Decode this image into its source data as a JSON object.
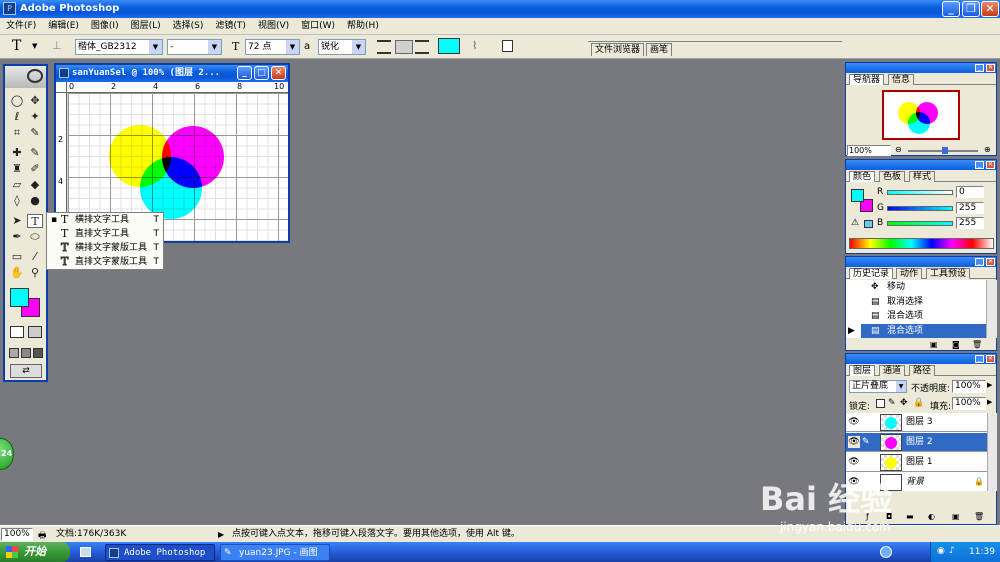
{
  "app": {
    "title": "Adobe Photoshop"
  },
  "menu": [
    "文件(F)",
    "编辑(E)",
    "图像(I)",
    "图层(L)",
    "选择(S)",
    "滤镜(T)",
    "视图(V)",
    "窗口(W)",
    "帮助(H)"
  ],
  "options": {
    "font_family": "楷体_GB2312",
    "font_style": "-",
    "font_size": "72 点",
    "aa_label": "a",
    "aa_value": "锐化",
    "tab_browser": "文件浏览器",
    "tab_brush": "画笔"
  },
  "document": {
    "title": "sanYuanSel @ 100% (图层 2..."
  },
  "ruler": {
    "h": [
      "0",
      "2",
      "4",
      "6",
      "8",
      "10"
    ],
    "v": [
      "2",
      "4"
    ]
  },
  "flyout": [
    {
      "label": "横排文字工具",
      "key": "T",
      "icon": "T"
    },
    {
      "label": "直排文字工具",
      "key": "T",
      "icon": "T"
    },
    {
      "label": "横排文字蒙版工具",
      "key": "T",
      "icon": "T"
    },
    {
      "label": "直排文字蒙版工具",
      "key": "T",
      "icon": "T"
    }
  ],
  "navigator": {
    "tabs": [
      "导航器",
      "信息"
    ],
    "zoom": "100%"
  },
  "color": {
    "tabs": [
      "颜色",
      "色板",
      "样式"
    ],
    "r_label": "R",
    "g_label": "G",
    "b_label": "B",
    "r": "0",
    "g": "255",
    "b": "255"
  },
  "history": {
    "tabs": [
      "历史记录",
      "动作",
      "工具预设"
    ],
    "items": [
      "移动",
      "取消选择",
      "混合选项",
      "混合选项"
    ]
  },
  "layers": {
    "tabs": [
      "图层",
      "通道",
      "路径"
    ],
    "blend": "正片叠底",
    "opacity_label": "不透明度:",
    "opacity": "100%",
    "lock_label": "锁定:",
    "fill_label": "填充:",
    "fill": "100%",
    "items": [
      "图层 3",
      "图层 2",
      "图层 1",
      "背景"
    ]
  },
  "status": {
    "zoom": "100%",
    "doc": "文档:176K/363K",
    "hint": "点按可键入点文本，拖移可键入段落文字。要用其他选项，使用 Alt 键。"
  },
  "badge": "24",
  "watermark": {
    "logo": "Bai 经验",
    "url": "jingyan.baidu.com"
  },
  "taskbar": {
    "start": "开始",
    "items": [
      "Adobe Photoshop",
      "yuan23.JPG - 画图"
    ],
    "clock": "11:39"
  }
}
